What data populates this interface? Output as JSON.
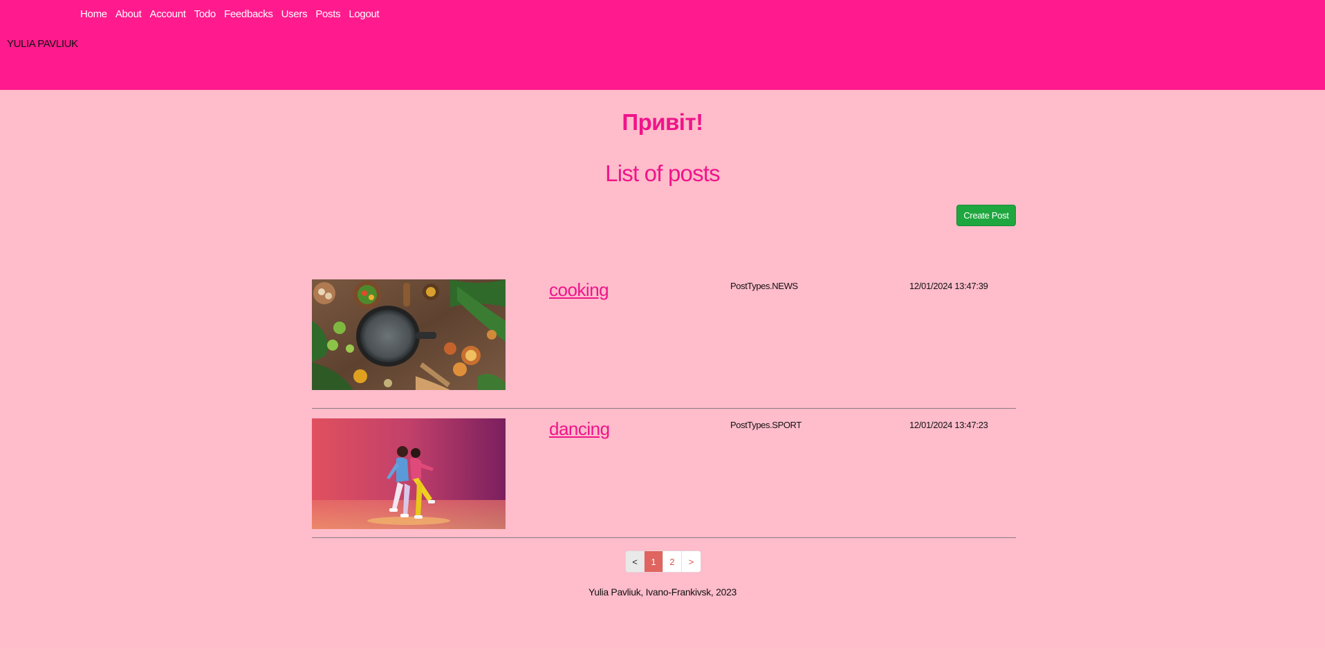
{
  "nav": {
    "items": [
      {
        "label": "Home"
      },
      {
        "label": "About"
      },
      {
        "label": "Account"
      },
      {
        "label": "Todo"
      },
      {
        "label": "Feedbacks"
      },
      {
        "label": "Users"
      },
      {
        "label": "Posts"
      },
      {
        "label": "Logout"
      }
    ],
    "brand": "YULIA PAVLIUK"
  },
  "main": {
    "greeting": "Привіт!",
    "title": "List of posts",
    "create_button": "Create Post"
  },
  "posts": [
    {
      "title": "cooking",
      "type": "PostTypes.NEWS",
      "date": "12/01/2024 13:47:39",
      "image": "cooking-photo"
    },
    {
      "title": "dancing",
      "type": "PostTypes.SPORT",
      "date": "12/01/2024 13:47:23",
      "image": "dancing-photo"
    }
  ],
  "pagination": {
    "prev": "<",
    "pages": [
      "1",
      "2"
    ],
    "next": ">",
    "current": "1"
  },
  "footer": {
    "text": "Yulia Pavliuk, Ivano-Frankivsk, 2023"
  },
  "colors": {
    "header_bg": "#ff1b8d",
    "page_bg": "#ffbccb",
    "accent": "#f0148a",
    "create_button": "#1fa73f"
  }
}
